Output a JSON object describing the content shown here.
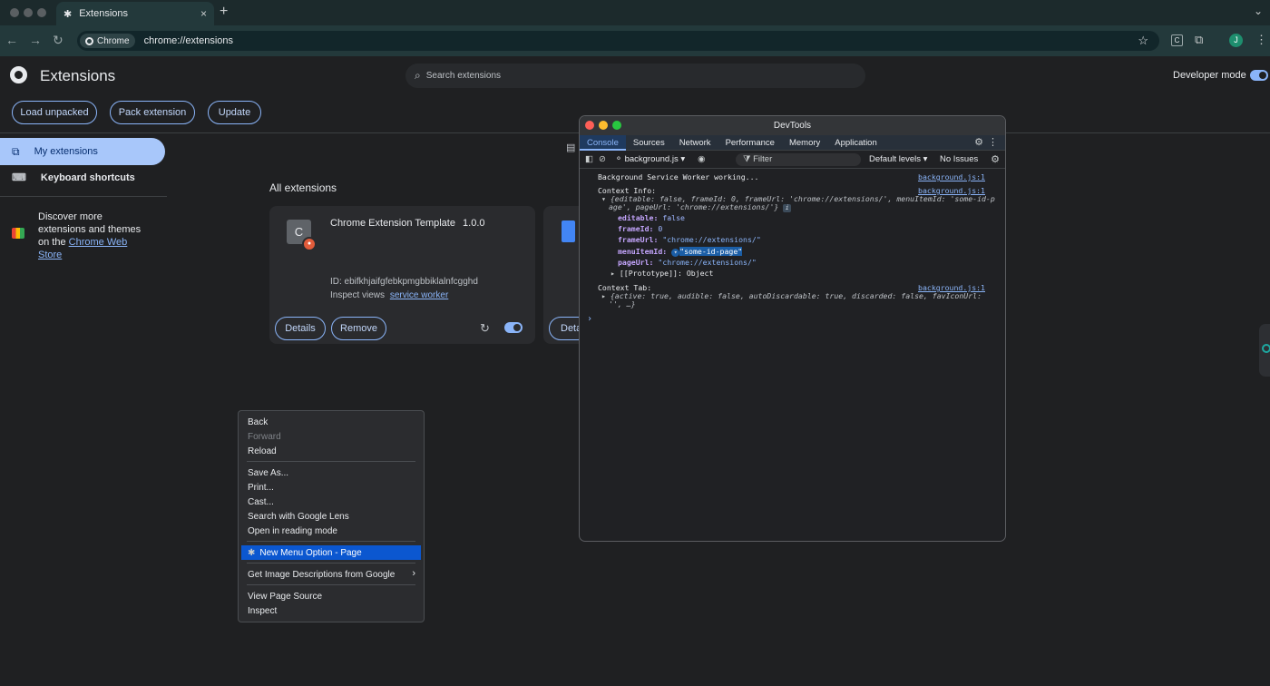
{
  "browser": {
    "tab_title": "Extensions",
    "tab_close": "×",
    "new_tab": "+",
    "strip_menu": "⌄",
    "chip_label": "Chrome",
    "url": "chrome://extensions",
    "star": "☆",
    "ext_badge": "C",
    "puzzle": "⧉",
    "avatar": "J",
    "menu": "⋮",
    "back": "←",
    "forward": "→",
    "reload": "↻"
  },
  "header": {
    "title": "Extensions",
    "search_placeholder": "Search extensions",
    "search_icon": "⌕",
    "developer_mode_label": "Developer mode",
    "developer_mode_on": true
  },
  "actions": {
    "load_unpacked": "Load unpacked",
    "pack_extension": "Pack extension",
    "update": "Update"
  },
  "sidebar": {
    "my_extensions": "My extensions",
    "keyboard_shortcuts": "Keyboard shortcuts",
    "discover_text": "Discover more extensions and themes on the",
    "web_store_link": "Chrome Web Store",
    "my_ext_icon": "⧉",
    "kb_icon": "⌨"
  },
  "main": {
    "section_title": "All extensions",
    "list_icon": "▤",
    "extension": {
      "icon_letter": "C",
      "name": "Chrome Extension Template",
      "version": "1.0.0",
      "id_line": "ID: ebifkhjaifgfebkpmgbbiklalnfcgghd",
      "inspect_label": "Inspect views",
      "inspect_link": "service worker",
      "details": "Details",
      "remove": "Remove",
      "reload_icon": "↻",
      "enabled": true
    },
    "second_card_details": "Deta"
  },
  "context_menu": {
    "items": [
      "Back",
      "Forward",
      "Reload",
      "Save As...",
      "Print...",
      "Cast...",
      "Search with Google Lens",
      "Open in reading mode",
      "New Menu Option - Page",
      "Get Image Descriptions from Google",
      "View Page Source",
      "Inspect"
    ],
    "submenu_arrow": "›",
    "ext_icon": "✱"
  },
  "devtools": {
    "title": "DevTools",
    "tabs": [
      "Console",
      "Sources",
      "Network",
      "Performance",
      "Memory",
      "Application"
    ],
    "context": "background.js",
    "filter_placeholder": "Filter",
    "levels": "Default levels",
    "issues": "No Issues",
    "console": {
      "l1": "Background Service Worker working...",
      "l2": "Context Info:",
      "l3": "Context Tab:",
      "source": "background.js:1",
      "prompt": "›",
      "obj_summary_a": "{editable: false, frameId: 0, frameUrl: 'chrome://extensions/', menuItemId: 'some-id-p",
      "obj_summary_b": "age', pageUrl: 'chrome://extensions/'}",
      "p_editable_k": "editable",
      "p_editable_v": "false",
      "p_frameId_k": "frameId",
      "p_frameId_v": "0",
      "p_frameUrl_k": "frameUrl",
      "p_frameUrl_v": "\"chrome://extensions/\"",
      "p_menu_k": "menuItemId",
      "p_menu_v": "\"some-id-page\"",
      "p_page_k": "pageUrl",
      "p_page_v": "\"chrome://extensions/\"",
      "proto": "[[Prototype]]: Object",
      "tab_summary_a": "{active: true, audible: false, autoDiscardable: true, discarded: false, favIconUrl:",
      "tab_summary_b": "'', …}"
    }
  }
}
